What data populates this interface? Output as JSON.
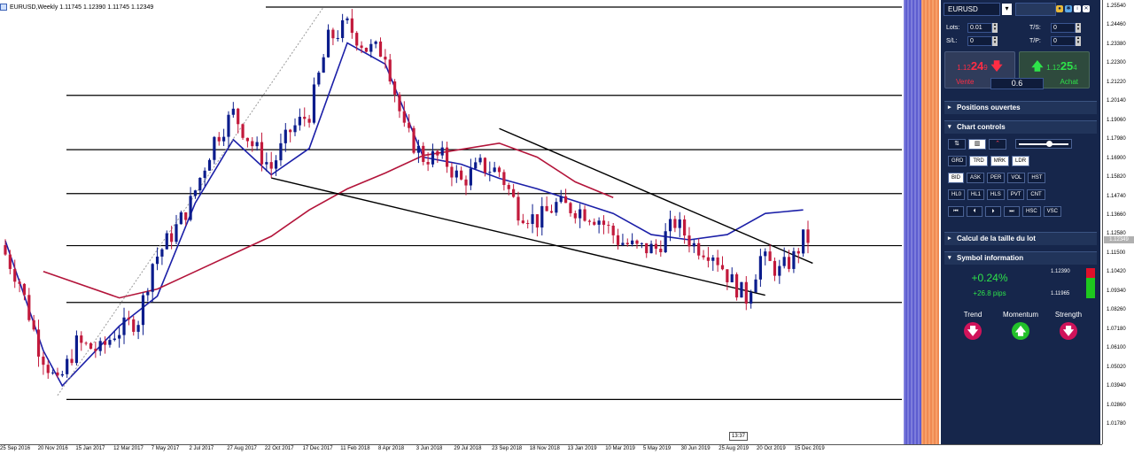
{
  "chart": {
    "title": "EURUSD,Weekly  1.11745 1.12390 1.11745 1.12349",
    "time_box": "13:37",
    "current_price_marker": "1.12349",
    "price_labels": [
      "1.25540",
      "1.24460",
      "1.23380",
      "1.22300",
      "1.21220",
      "1.20140",
      "1.19060",
      "1.17980",
      "1.16900",
      "1.15820",
      "1.14740",
      "1.13660",
      "1.12580",
      "1.11500",
      "1.10420",
      "1.09340",
      "1.08260",
      "1.07180",
      "1.06100",
      "1.05020",
      "1.03940",
      "1.02860",
      "1.01780"
    ],
    "date_labels": [
      "25 Sep 2016",
      "20 Nov 2016",
      "15 Jan 2017",
      "12 Mar 2017",
      "7 May 2017",
      "2 Jul 2017",
      "27 Aug 2017",
      "22 Oct 2017",
      "17 Dec 2017",
      "11 Feb 2018",
      "8 Apr 2018",
      "3 Jun 2018",
      "29 Jul 2018",
      "23 Sep 2018",
      "18 Nov 2018",
      "13 Jan 2019",
      "10 Mar 2019",
      "5 May 2019",
      "30 Jun 2019",
      "25 Aug 2019",
      "20 Oct 2019",
      "15 Dec 2019"
    ],
    "colors": {
      "bull": "#0b1c8c",
      "bear": "#c21a3c",
      "ma_fast": "#1b1fa8",
      "ma_slow": "#b3143a",
      "level_line": "#000000",
      "stripe_blue": "#6767d4",
      "stripe_orange": "#f3955c"
    }
  },
  "chart_data": {
    "type": "candlestick",
    "title": "EURUSD,Weekly",
    "ohlc_header": {
      "open": 1.11745,
      "high": 1.1239,
      "low": 1.11745,
      "close": 1.12349
    },
    "x_range": [
      "2016-09-25",
      "2019-12-22"
    ],
    "ylim": [
      1.0178,
      1.2554
    ],
    "horizontal_levels": [
      1.2554,
      1.2052,
      1.1743,
      1.1493,
      1.1197,
      1.0874,
      1.0322
    ],
    "trendlines": [
      {
        "from": {
          "date": "2018-09-23",
          "price": 1.1863
        },
        "to": {
          "date": "2019-12-29",
          "price": 1.1097
        }
      },
      {
        "from": {
          "date": "2017-10-22",
          "price": 1.1582
        },
        "to": {
          "date": "2019-10-20",
          "price": 1.0915
        }
      },
      {
        "from": {
          "date": "2016-12-11",
          "price": 1.0345
        },
        "to": {
          "date": "2018-01-07",
          "price": 1.2554
        },
        "style": "dotted"
      }
    ],
    "series": [
      {
        "values": [
          [
            "2016-09-25",
            1.1225
          ],
          [
            "2016-11-20",
            1.06
          ],
          [
            "2016-12-18",
            1.04
          ],
          [
            "2017-03-12",
            1.074
          ],
          [
            "2017-05-07",
            1.091
          ],
          [
            "2017-07-02",
            1.144
          ],
          [
            "2017-08-27",
            1.18
          ],
          [
            "2017-10-22",
            1.16
          ],
          [
            "2017-12-17",
            1.175
          ],
          [
            "2018-02-11",
            1.235
          ],
          [
            "2018-04-08",
            1.223
          ],
          [
            "2018-06-03",
            1.17
          ],
          [
            "2018-07-29",
            1.166
          ],
          [
            "2018-09-23",
            1.158
          ],
          [
            "2018-11-18",
            1.152
          ],
          [
            "2019-01-13",
            1.145
          ],
          [
            "2019-03-10",
            1.138
          ],
          [
            "2019-05-05",
            1.126
          ],
          [
            "2019-06-30",
            1.123
          ],
          [
            "2019-08-25",
            1.126
          ],
          [
            "2019-10-20",
            1.138
          ],
          [
            "2019-12-15",
            1.14
          ]
        ]
      },
      {
        "values": [
          [
            "2016-11-20",
            1.105
          ],
          [
            "2017-03-12",
            1.09
          ],
          [
            "2017-05-07",
            1.095
          ],
          [
            "2017-07-02",
            1.105
          ],
          [
            "2017-08-27",
            1.115
          ],
          [
            "2017-10-22",
            1.125
          ],
          [
            "2017-12-17",
            1.14
          ],
          [
            "2018-02-11",
            1.152
          ],
          [
            "2018-04-08",
            1.161
          ],
          [
            "2018-06-03",
            1.171
          ],
          [
            "2018-09-23",
            1.178
          ],
          [
            "2018-11-18",
            1.17
          ],
          [
            "2019-01-13",
            1.156
          ],
          [
            "2019-03-10",
            1.147
          ]
        ]
      }
    ]
  },
  "panel": {
    "symbol": "EURUSD",
    "lots_label": "Lots:",
    "lots_value": "0.01",
    "ts_label": "T/S:",
    "ts_value": "0",
    "sl_label": "S/L:",
    "sl_value": "0",
    "tp_label": "T/P:",
    "tp_value": "0",
    "sell": {
      "prefix": "1.12",
      "big": "24",
      "small": "9",
      "caption": "Vente"
    },
    "buy": {
      "prefix": "1.12",
      "big": "25",
      "small": "4",
      "caption": "Achat"
    },
    "quantity": "0.6",
    "sections": {
      "positions": "Positions ouvertes",
      "chart_controls": "Chart controls",
      "lot_calc": "Calcul de la taille du lot",
      "symbol_info": "Symbol information"
    },
    "cc_row2": [
      "GRD",
      "TRD",
      "MRK",
      "LDR"
    ],
    "cc_row3": [
      "BID",
      "ASK",
      "PER",
      "VOL",
      "HST"
    ],
    "cc_row4": [
      "HL0",
      "HL1",
      "HLS",
      "PVT",
      "CNT"
    ],
    "cc_row5": [
      "⏮",
      "⏴",
      "⏵",
      "⏭",
      "HSC",
      "VSC"
    ],
    "symbol_info": {
      "change_pct": "+0.24%",
      "change_pips": "+26.8 pips",
      "high": "1.12390",
      "low": "1.11965",
      "trend_label": "Trend",
      "momentum_label": "Momentum",
      "strength_label": "Strength"
    }
  }
}
